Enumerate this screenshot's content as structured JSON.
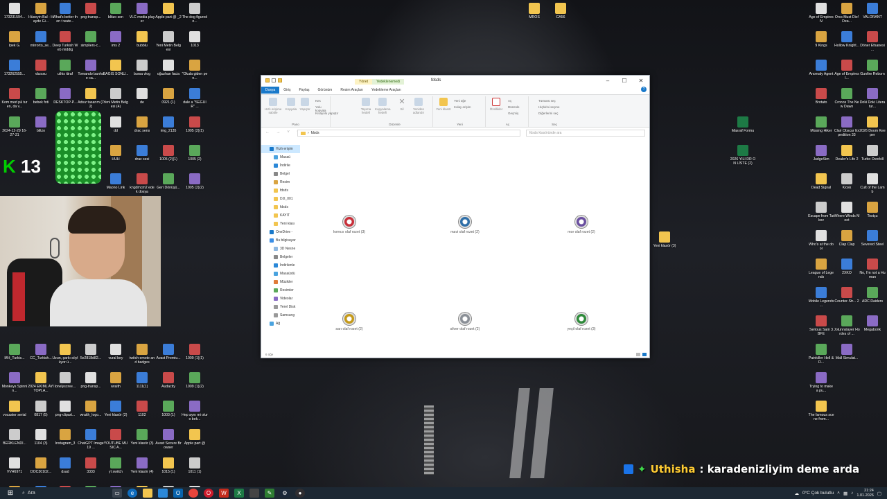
{
  "desktop": {
    "col1": [
      "173231594...",
      "İpek G.",
      "173262555...",
      "Kom med på turen, da v...",
      "2024-12-29 16-27-31",
      "",
      "",
      "",
      "",
      "",
      "",
      "",
      "MH_Turkis...",
      "Monkeys Spinnin...",
      "vocaster serial",
      "BERKLENDİ...",
      "VVH6971",
      "SAWR1690"
    ],
    "col2": [
      "Hüseyin Bal - Hayde Gi...",
      "mirrorto_se...",
      "vbzsxu",
      "bebek foti",
      "blitzo",
      "",
      "",
      "",
      "",
      "",
      "",
      "",
      "CC_Turkish...",
      "2024 EKİML AYI TOPLA...",
      "0817 (5)",
      "1104 (3)",
      "DOC30102...",
      "BAĞIS SONUÇ BİL..."
    ],
    "col3": [
      "What's better then t wate...",
      "Deep Turkish Web middig",
      "uthis itiraf",
      "DESKTOP-P...",
      "",
      "",
      "",
      "",
      "",
      "",
      "",
      "",
      "Uzun, şarkı söylüyor ü...",
      "lonelyscree...",
      "png-clipart...",
      "Instagram_3",
      "dsad",
      "ChatGPT Image 19 ..."
    ],
    "col4": [
      "png-transp...",
      "simpliers-c...",
      "Tomando banho e ca...",
      "Adsız tasarım (12)",
      "",
      "",
      "",
      "",
      "",
      "",
      "",
      "",
      "5e2818d82...",
      "png-transp...",
      "wraith_logo...",
      "ChatGPT Image 19 ...",
      "3333",
      "png-transp..."
    ],
    "col5": [
      "blitzo son",
      "ims 2",
      "BAGIS SONU...",
      "Yeni Metin Belgesi (4)",
      "dd",
      "HUH",
      "Maono Link",
      "",
      "",
      "",
      "",
      "",
      "vural bey",
      "wraith",
      "Yeni klasör (2)",
      "YOUTUBE MUSIC A...",
      "yt switch",
      "zip dosyalar"
    ],
    "col6": [
      "VLC media player",
      "bubblu",
      "bursa vlog",
      "de",
      "drac sens",
      "drac sesi",
      "kngdmcm2 edek dosya",
      "",
      "",
      "",
      "",
      "",
      "twitch emote and badges",
      "1111(1)",
      "1102",
      "Yeni klasör (3)",
      "Yeni klasör (4)",
      "Emperor penguin pa..."
    ],
    "col7": [
      "Apple part @ _2",
      "Yeni Metin Belgesi",
      "oğuzhan facia",
      "0921 (1)",
      "img_2135",
      "1005 (2)(1)",
      "Geri Dönüşü...",
      "",
      "",
      "",
      "",
      "",
      "Avast Premiu...",
      "Audacity",
      "1003 (1)",
      "Avast Secure Browser",
      "1015 (1)",
      "OBSBOT Center"
    ],
    "col8": [
      "The dog figured o...",
      "1013",
      "\"Okula giden pen...",
      "dale a \"SEGUIR\" ...",
      "1005 (2)(1)",
      "1005 (2)",
      "1005 (2)(2)",
      "",
      "",
      "",
      "",
      "",
      "1009 (1)(1)",
      "1009 (1)(2)",
      "Hep aynı mi olur o bek...",
      "Apple part @",
      "1011 (1)",
      "Barks Big... Until the Gi..."
    ],
    "top_right_a": [
      "MROS",
      "",
      "",
      "",
      ""
    ],
    "top_right_b": [
      "CA56",
      "",
      "",
      "",
      ""
    ],
    "right1": [
      "Age of Empires IV",
      "9 Kings",
      "Anomaly Agent",
      "Brotato",
      "Missing Hiker",
      "JudgeSim",
      "Dead Signal",
      "Escape from Tarkov",
      "Who's at the door",
      "League of Legends",
      "Mobile Legends ...",
      "Serious Sam 3 BFE",
      "Painkiller Hell & D...",
      "Trying to make a pu...",
      "The famous scene from..."
    ],
    "right2": [
      "Orcs Must Die! Dea...",
      "Hollow Knight...",
      "Age of Empires I...",
      "Cronos The New Dawn",
      "Clair Obscur Expedition 33",
      "Dealer's Life 2",
      "Kiosk",
      "Where Winds Meet",
      "Clap Clap",
      "2XKO",
      "Counter-Str... 2",
      "Jotunnslayer Hordes of ...",
      "Mall Simulat...",
      "",
      ""
    ],
    "right3": [
      "VALORANT",
      "Döner Efsanesi ...",
      "Gunfire Reborn",
      "Doki Doki Literatur...",
      "2026 Doom Keeper",
      "Turbo Overkill",
      "Cult of the Lamb",
      "Tostçu",
      "Severed Steel",
      "No, I'm not a Human",
      "ARC Raiders",
      "Megabonk",
      "",
      "",
      ""
    ],
    "mid_right": [
      "Masraf Formu",
      "2026 YILI DR ON LİSTE (2)"
    ],
    "yeni_klasor": "Yeni klasör (3)"
  },
  "explorer": {
    "title": "fdsds",
    "context_tabs": [
      "Yönet",
      "Yedeklenemedi"
    ],
    "ribbon_tabs": [
      "Dosya",
      "Giriş",
      "Paylaş",
      "Görünüm",
      "Resim Araçları",
      "Yedekleme Araçları"
    ],
    "ribbon": {
      "pin_label": "Hızlı erişime sabitle",
      "copy_label": "Kopyala",
      "paste_label": "Yapıştır",
      "cut_label": "Kes",
      "copy_path_label": "Yolu kopyala",
      "paste_shortcut_label": "Kısayolu yapıştır",
      "pano_group": "Pano",
      "move_label": "Taşıma hedefi",
      "copyto_label": "Kopyalama hedefi",
      "delete_label": "Sil",
      "rename_label": "Yeniden adlandır",
      "duzenle_group": "Düzenle",
      "newfolder_label": "Yeni klasör",
      "newitem_label": "Yeni öğe",
      "easyaccess_label": "Kolay erişim",
      "yeni_group": "Yeni",
      "props_label": "Özellikler",
      "open_label": "Aç",
      "edit_label": "Düzenle",
      "history_label": "Geçmiş",
      "ac_group": "Aç",
      "selectall_label": "Tümünü seç",
      "selectnone_label": "Hiçbirini seçme",
      "invert_label": "Diğerlerini seç",
      "sec_group": "Seç"
    },
    "address": "fdsds",
    "search_placeholder": "fdsds klasöründe ara",
    "nav": [
      "Hızlı erişim",
      "Masaü",
      "İndirile",
      "Belgel",
      "Resim",
      "fdsds",
      "DJI_001",
      "fdsds",
      "KAYIT",
      "Yeni klası",
      "OneDrive -",
      "Bu bilgisayar",
      "3D Nesne",
      "Belgeler",
      "İndirilenle",
      "Masaüstü",
      "Müzikler",
      "Resimler",
      "Videolar",
      "Yerel Disk",
      "Samsung",
      "Ağ"
    ],
    "files": [
      {
        "name": "kırmızı olaf rozet (3)",
        "color": "#c8303a"
      },
      {
        "name": "mavi olaf rozet (2)",
        "color": "#2f6fa8"
      },
      {
        "name": "mor olaf rozet (2)",
        "color": "#6a4fa0"
      },
      {
        "name": "sarı olaf rozet (2)",
        "color": "#c59a1a"
      },
      {
        "name": "silver olaf rozet (2)",
        "color": "#8a8f96"
      },
      {
        "name": "yeşil olaf rozet (3)",
        "color": "#2e8a3a"
      }
    ],
    "status": "6 öğe"
  },
  "chat": {
    "user": "Uthisha",
    "message": ": karadenizliyim deme arda"
  },
  "taskbar": {
    "search": "Ara",
    "weather": "0°C Çok bulutlu",
    "time": "21:24",
    "date": "1.01.2026"
  },
  "colors": {
    "accent": "#1979ca",
    "taskbar": "#1d2833",
    "chat_user": "#ffcc33"
  }
}
